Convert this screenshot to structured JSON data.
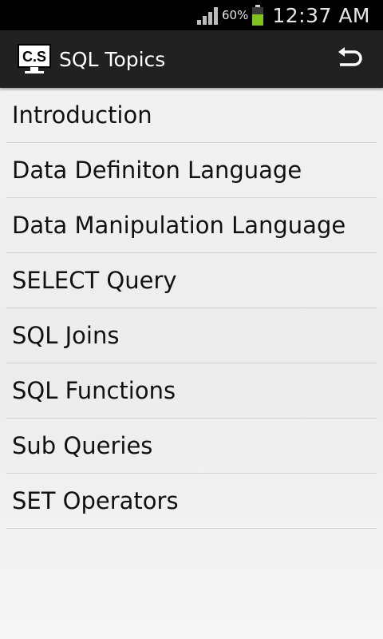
{
  "status_bar": {
    "battery_percent": "60%",
    "time": "12:37 AM",
    "battery_color": "#7fc31c"
  },
  "action_bar": {
    "icon_text": "C.S",
    "title": "SQL Topics",
    "background": "#212121"
  },
  "topics": [
    {
      "label": "Introduction"
    },
    {
      "label": "Data Definiton Language"
    },
    {
      "label": "Data Manipulation Language"
    },
    {
      "label": "SELECT Query"
    },
    {
      "label": "SQL Joins"
    },
    {
      "label": "SQL Functions"
    },
    {
      "label": "Sub Queries"
    },
    {
      "label": "SET Operators"
    }
  ]
}
